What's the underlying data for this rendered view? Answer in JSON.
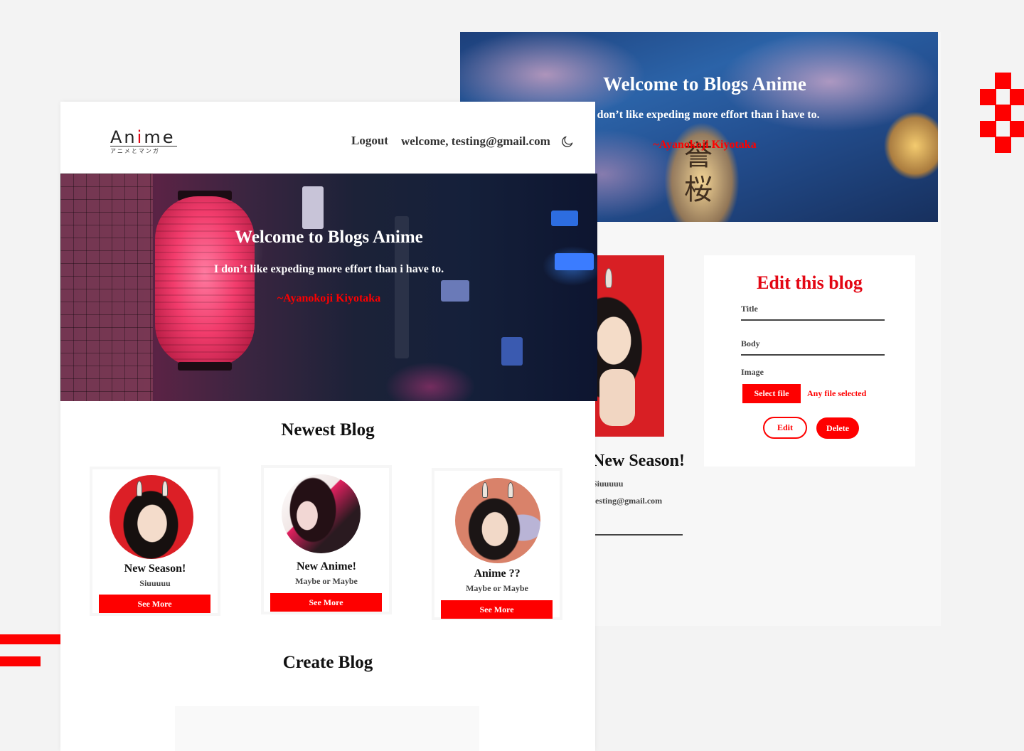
{
  "front": {
    "logo": {
      "text_pre": "An",
      "text_i": "i",
      "text_post": "me",
      "subtitle": "アニメとマンガ"
    },
    "nav": {
      "logout": "Logout",
      "welcome": "welcome, testing@gmail.com",
      "theme_icon": "moon-icon"
    },
    "hero": {
      "title": "Welcome  to Blogs Anime",
      "quote": "I don’t like expeding more effort than i have to.",
      "author": "~Ayanokoji Kiyotaka"
    },
    "newest_title": "Newest Blog",
    "cards": [
      {
        "title": "New Season!",
        "body": "Siuuuuu",
        "button": "See More"
      },
      {
        "title": "New Anime!",
        "body": "Maybe or Maybe",
        "button": "See More"
      },
      {
        "title": "Anime ??",
        "body": "Maybe or Maybe",
        "button": "See More"
      }
    ],
    "create_title": "Create Blog"
  },
  "back": {
    "hero": {
      "title": "Welcome  to Blogs Anime",
      "quote": "I don’t like expeding more effort than i have to.",
      "author": "~Ayanokoji Kiyotaka",
      "lantern_text": "誉桜"
    },
    "blog": {
      "title": "New Season!",
      "body": "Siuuuuu",
      "email": "testing@gmail.com"
    },
    "edit": {
      "heading": "Edit this blog",
      "title_label": "Title",
      "body_label": "Body",
      "image_label": "Image",
      "select_file": "Select file",
      "file_status": "Any file selected",
      "edit_button": "Edit",
      "delete_button": "Delete"
    }
  },
  "colors": {
    "accent": "#fe0000",
    "heading_red": "#e30613"
  }
}
